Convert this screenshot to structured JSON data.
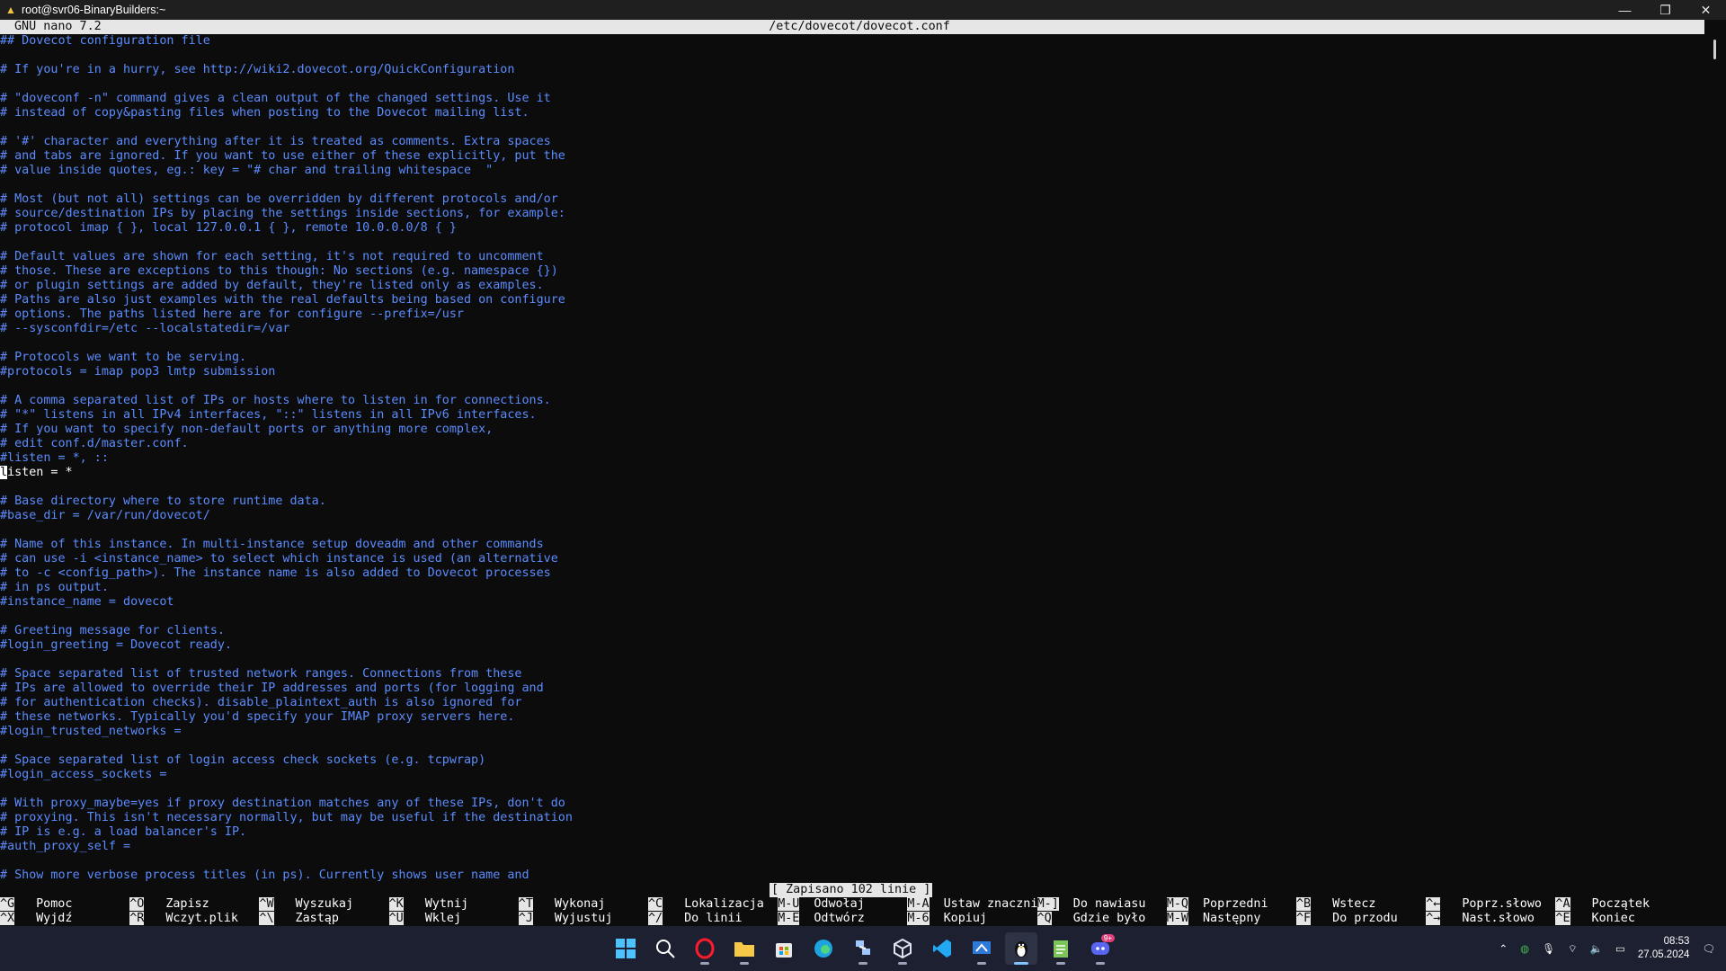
{
  "window": {
    "title": "root@svr06-BinaryBuilders:~",
    "controls": {
      "minimize": "—",
      "maximize": "❐",
      "close": "✕"
    }
  },
  "nano": {
    "version": "GNU nano 7.2",
    "filename": "/etc/dovecot/dovecot.conf",
    "lines": [
      {
        "text": "## Dovecot configuration file",
        "kind": "comment"
      },
      {
        "text": "",
        "kind": "blank"
      },
      {
        "text": "# If you're in a hurry, see http://wiki2.dovecot.org/QuickConfiguration",
        "kind": "comment"
      },
      {
        "text": "",
        "kind": "blank"
      },
      {
        "text": "# \"doveconf -n\" command gives a clean output of the changed settings. Use it",
        "kind": "comment"
      },
      {
        "text": "# instead of copy&pasting files when posting to the Dovecot mailing list.",
        "kind": "comment"
      },
      {
        "text": "",
        "kind": "blank"
      },
      {
        "text": "# '#' character and everything after it is treated as comments. Extra spaces",
        "kind": "comment"
      },
      {
        "text": "# and tabs are ignored. If you want to use either of these explicitly, put the",
        "kind": "comment"
      },
      {
        "text": "# value inside quotes, eg.: key = \"# char and trailing whitespace  \"",
        "kind": "comment"
      },
      {
        "text": "",
        "kind": "blank"
      },
      {
        "text": "# Most (but not all) settings can be overridden by different protocols and/or",
        "kind": "comment"
      },
      {
        "text": "# source/destination IPs by placing the settings inside sections, for example:",
        "kind": "comment"
      },
      {
        "text": "# protocol imap { }, local 127.0.0.1 { }, remote 10.0.0.0/8 { }",
        "kind": "comment"
      },
      {
        "text": "",
        "kind": "blank"
      },
      {
        "text": "# Default values are shown for each setting, it's not required to uncomment",
        "kind": "comment"
      },
      {
        "text": "# those. These are exceptions to this though: No sections (e.g. namespace {})",
        "kind": "comment"
      },
      {
        "text": "# or plugin settings are added by default, they're listed only as examples.",
        "kind": "comment"
      },
      {
        "text": "# Paths are also just examples with the real defaults being based on configure",
        "kind": "comment"
      },
      {
        "text": "# options. The paths listed here are for configure --prefix=/usr",
        "kind": "comment"
      },
      {
        "text": "# --sysconfdir=/etc --localstatedir=/var",
        "kind": "comment"
      },
      {
        "text": "",
        "kind": "blank"
      },
      {
        "text": "# Protocols we want to be serving.",
        "kind": "comment"
      },
      {
        "text": "#protocols = imap pop3 lmtp submission",
        "kind": "comment"
      },
      {
        "text": "",
        "kind": "blank"
      },
      {
        "text": "# A comma separated list of IPs or hosts where to listen in for connections.",
        "kind": "comment"
      },
      {
        "text": "# \"*\" listens in all IPv4 interfaces, \"::\" listens in all IPv6 interfaces.",
        "kind": "comment"
      },
      {
        "text": "# If you want to specify non-default ports or anything more complex,",
        "kind": "comment"
      },
      {
        "text": "# edit conf.d/master.conf.",
        "kind": "comment"
      },
      {
        "text": "#listen = *, ::",
        "kind": "comment"
      },
      {
        "text": "isten = *",
        "kind": "code",
        "cursor_char": "l"
      },
      {
        "text": "",
        "kind": "blank"
      },
      {
        "text": "# Base directory where to store runtime data.",
        "kind": "comment"
      },
      {
        "text": "#base_dir = /var/run/dovecot/",
        "kind": "comment"
      },
      {
        "text": "",
        "kind": "blank"
      },
      {
        "text": "# Name of this instance. In multi-instance setup doveadm and other commands",
        "kind": "comment"
      },
      {
        "text": "# can use -i <instance_name> to select which instance is used (an alternative",
        "kind": "comment"
      },
      {
        "text": "# to -c <config_path>). The instance name is also added to Dovecot processes",
        "kind": "comment"
      },
      {
        "text": "# in ps output.",
        "kind": "comment"
      },
      {
        "text": "#instance_name = dovecot",
        "kind": "comment"
      },
      {
        "text": "",
        "kind": "blank"
      },
      {
        "text": "# Greeting message for clients.",
        "kind": "comment"
      },
      {
        "text": "#login_greeting = Dovecot ready.",
        "kind": "comment"
      },
      {
        "text": "",
        "kind": "blank"
      },
      {
        "text": "# Space separated list of trusted network ranges. Connections from these",
        "kind": "comment"
      },
      {
        "text": "# IPs are allowed to override their IP addresses and ports (for logging and",
        "kind": "comment"
      },
      {
        "text": "# for authentication checks). disable_plaintext_auth is also ignored for",
        "kind": "comment"
      },
      {
        "text": "# these networks. Typically you'd specify your IMAP proxy servers here.",
        "kind": "comment"
      },
      {
        "text": "#login_trusted_networks =",
        "kind": "comment"
      },
      {
        "text": "",
        "kind": "blank"
      },
      {
        "text": "# Space separated list of login access check sockets (e.g. tcpwrap)",
        "kind": "comment"
      },
      {
        "text": "#login_access_sockets =",
        "kind": "comment"
      },
      {
        "text": "",
        "kind": "blank"
      },
      {
        "text": "# With proxy_maybe=yes if proxy destination matches any of these IPs, don't do",
        "kind": "comment"
      },
      {
        "text": "# proxying. This isn't necessary normally, but may be useful if the destination",
        "kind": "comment"
      },
      {
        "text": "# IP is e.g. a load balancer's IP.",
        "kind": "comment"
      },
      {
        "text": "#auth_proxy_self =",
        "kind": "comment"
      },
      {
        "text": "",
        "kind": "blank"
      },
      {
        "text": "# Show more verbose process titles (in ps). Currently shows user name and",
        "kind": "comment"
      }
    ],
    "status_message": "[ Zapisano 102 linie ]",
    "shortcuts_row1": [
      {
        "key": "^G",
        "label": "Pomoc"
      },
      {
        "key": "^O",
        "label": "Zapisz"
      },
      {
        "key": "^W",
        "label": "Wyszukaj"
      },
      {
        "key": "^K",
        "label": "Wytnij"
      },
      {
        "key": "^T",
        "label": "Wykonaj"
      },
      {
        "key": "^C",
        "label": "Lokalizacja"
      },
      {
        "key": "M-U",
        "label": "Odwołaj"
      },
      {
        "key": "M-A",
        "label": "Ustaw znacznik"
      },
      {
        "key": "M-]",
        "label": "Do nawiasu"
      },
      {
        "key": "M-Q",
        "label": "Poprzedni"
      },
      {
        "key": "^B",
        "label": "Wstecz"
      },
      {
        "key": "^←",
        "label": "Poprz.słowo"
      },
      {
        "key": "^A",
        "label": "Początek"
      }
    ],
    "shortcuts_row2": [
      {
        "key": "^X",
        "label": "Wyjdź"
      },
      {
        "key": "^R",
        "label": "Wczyt.plik"
      },
      {
        "key": "^\\",
        "label": "Zastąp"
      },
      {
        "key": "^U",
        "label": "Wklej"
      },
      {
        "key": "^J",
        "label": "Wyjustuj"
      },
      {
        "key": "^/",
        "label": "Do linii"
      },
      {
        "key": "M-E",
        "label": "Odtwórz"
      },
      {
        "key": "M-6",
        "label": "Kopiuj"
      },
      {
        "key": "^Q",
        "label": "Gdzie było"
      },
      {
        "key": "M-W",
        "label": "Następny"
      },
      {
        "key": "^F",
        "label": "Do przodu"
      },
      {
        "key": "^→",
        "label": "Nast.słowo"
      },
      {
        "key": "^E",
        "label": "Koniec"
      }
    ]
  },
  "taskbar": {
    "apps": [
      {
        "name": "start",
        "icon": "windows-logo"
      },
      {
        "name": "search",
        "icon": "search-icon"
      },
      {
        "name": "opera",
        "icon": "opera-icon"
      },
      {
        "name": "file-explorer",
        "icon": "folder-icon"
      },
      {
        "name": "store",
        "icon": "store-icon"
      },
      {
        "name": "edge",
        "icon": "edge-icon"
      },
      {
        "name": "network-tool",
        "icon": "network-icon"
      },
      {
        "name": "virtualbox",
        "icon": "cube-icon"
      },
      {
        "name": "vscode",
        "icon": "vscode-icon"
      },
      {
        "name": "remote-desktop",
        "icon": "remote-desktop-icon"
      },
      {
        "name": "terminal",
        "icon": "penguin-icon"
      },
      {
        "name": "notepad",
        "icon": "notepad-icon"
      },
      {
        "name": "discord",
        "icon": "discord-icon"
      }
    ],
    "discord_badge": "9+",
    "clock": {
      "time": "08:53",
      "date": "27.05.2024"
    }
  },
  "colors": {
    "terminal_bg": "#0c0c0c",
    "comment": "#5b8cff",
    "header_bg": "#e6e6e6",
    "taskbar_bg": "#1c2030"
  }
}
